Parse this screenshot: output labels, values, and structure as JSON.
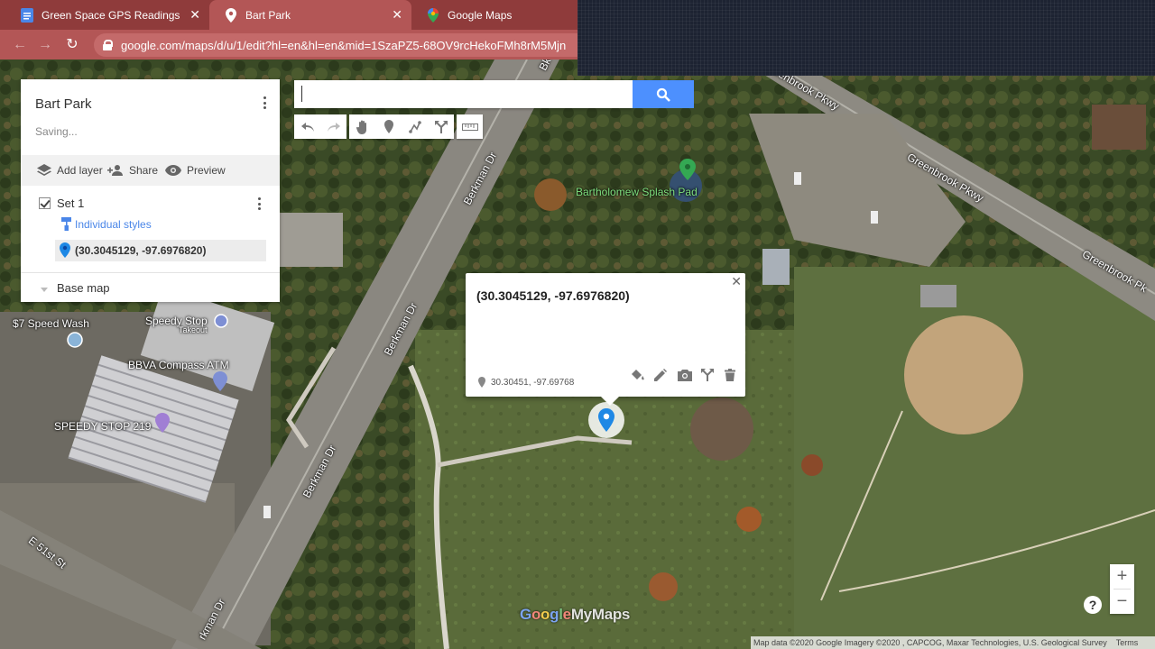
{
  "browser": {
    "tabs": [
      {
        "title": "Green Space GPS Readings - Goo",
        "icon": "docs-icon",
        "active": false
      },
      {
        "title": "Bart Park",
        "icon": "map-pin-icon",
        "active": true
      },
      {
        "title": "Google Maps",
        "icon": "google-maps-icon",
        "active": false
      }
    ],
    "url": "google.com/maps/d/u/1/edit?hl=en&hl=en&mid=1SzaPZ5-68OV9rcHekoFMh8rM5Mjn",
    "close_glyph": "✕"
  },
  "panel": {
    "title": "Bart Park",
    "status": "Saving...",
    "actions": {
      "add_layer": "Add layer",
      "share": "Share",
      "preview": "Preview"
    },
    "layer": {
      "name": "Set 1",
      "checked": true,
      "style_link": "Individual styles",
      "feature": "(30.3045129, -97.6976820)"
    },
    "base_map": "Base map"
  },
  "search": {
    "value": "",
    "placeholder": ""
  },
  "toolbar_icons": [
    "undo-icon",
    "redo-icon",
    "hand-icon",
    "marker-icon",
    "draw-line-icon",
    "directions-icon",
    "ruler-icon"
  ],
  "info_window": {
    "title": "(30.3045129, -97.6976820)",
    "coords": "30.30451, -97.69768",
    "actions": [
      "paint-bucket-icon",
      "edit-icon",
      "camera-icon",
      "directions-icon",
      "delete-icon"
    ]
  },
  "map_labels": {
    "berkman_1": "Berkman Dr",
    "berkman_2": "Berkman Dr",
    "berkman_3": "Berkman Dr",
    "berkman_4": "rkman Dr",
    "greenbrook_1": "Greenbrook Pkwy",
    "greenbrook_2": "Greenbrook Pkwy",
    "greenbrook_3": "Greenbrook Pk",
    "street_51": "E 51st St",
    "splash_pad": "Bartholomew Splash Pad",
    "speedy_stop": "Speedy Stop",
    "takeout": "Takeout",
    "bbva": "BBVA Compass ATM",
    "speedy_stop_219": "SPEEDY STOP 219",
    "wash": "$7 Speed Wash",
    "bk": "Bk"
  },
  "zoom": {
    "in": "+",
    "out": "−"
  },
  "help": "?",
  "attribution": {
    "text": "Map data ©2020 Google Imagery ©2020 , CAPCOG, Maxar Technologies, U.S. Geological Survey",
    "terms": "Terms"
  },
  "logo": "Google My Maps",
  "colors": {
    "accent": "#4d90fe",
    "pin_blue": "#1e88e5",
    "pin_green": "#34a853",
    "tab_bar": "#8f3b3b"
  }
}
